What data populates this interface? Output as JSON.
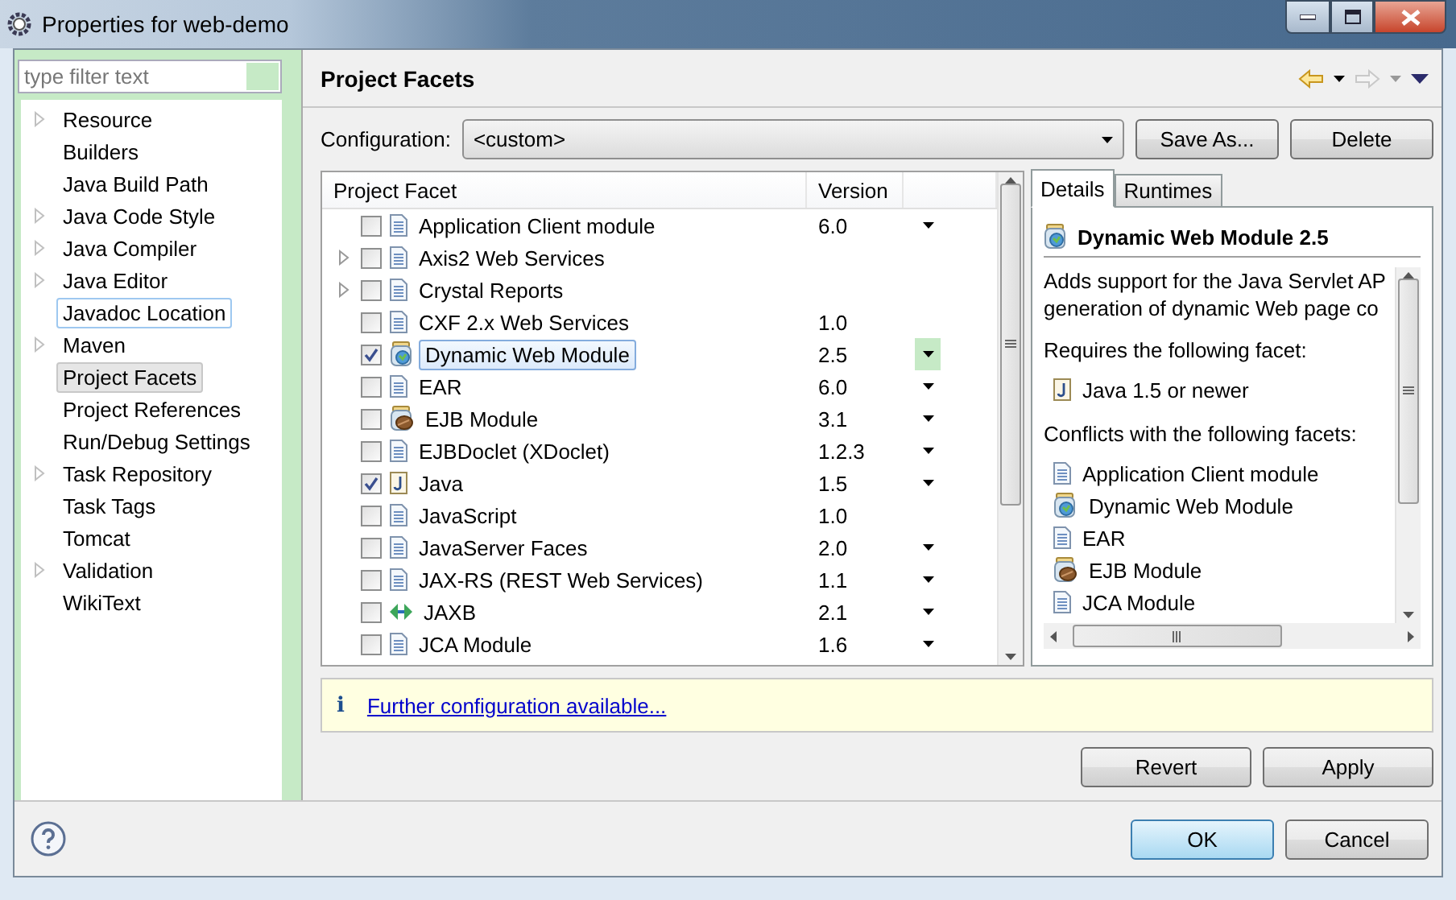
{
  "window": {
    "title": "Properties for web-demo"
  },
  "filter": {
    "placeholder": "type filter text"
  },
  "sidebar": {
    "items": [
      {
        "label": "Resource",
        "expandable": true,
        "selected": false,
        "hovered": false
      },
      {
        "label": "Builders",
        "expandable": false,
        "selected": false,
        "hovered": false
      },
      {
        "label": "Java Build Path",
        "expandable": false,
        "selected": false,
        "hovered": false
      },
      {
        "label": "Java Code Style",
        "expandable": true,
        "selected": false,
        "hovered": false
      },
      {
        "label": "Java Compiler",
        "expandable": true,
        "selected": false,
        "hovered": false
      },
      {
        "label": "Java Editor",
        "expandable": true,
        "selected": false,
        "hovered": false
      },
      {
        "label": "Javadoc Location",
        "expandable": false,
        "selected": false,
        "hovered": true
      },
      {
        "label": "Maven",
        "expandable": true,
        "selected": false,
        "hovered": false
      },
      {
        "label": "Project Facets",
        "expandable": false,
        "selected": true,
        "hovered": false
      },
      {
        "label": "Project References",
        "expandable": false,
        "selected": false,
        "hovered": false
      },
      {
        "label": "Run/Debug Settings",
        "expandable": false,
        "selected": false,
        "hovered": false
      },
      {
        "label": "Task Repository",
        "expandable": true,
        "selected": false,
        "hovered": false
      },
      {
        "label": "Task Tags",
        "expandable": false,
        "selected": false,
        "hovered": false
      },
      {
        "label": "Tomcat",
        "expandable": false,
        "selected": false,
        "hovered": false
      },
      {
        "label": "Validation",
        "expandable": true,
        "selected": false,
        "hovered": false
      },
      {
        "label": "WikiText",
        "expandable": false,
        "selected": false,
        "hovered": false
      }
    ]
  },
  "page": {
    "title": "Project Facets"
  },
  "configuration": {
    "label": "Configuration:",
    "value": "<custom>",
    "buttons": [
      "Save As...",
      "Delete"
    ]
  },
  "table": {
    "columns": [
      "Project Facet",
      "Version"
    ],
    "rows": [
      {
        "kind": "doc",
        "label": "Application Client module",
        "version": "6.0",
        "menu": true,
        "checked": false,
        "expandable": false,
        "selected": false
      },
      {
        "kind": "doc",
        "label": "Axis2 Web Services",
        "menu": false,
        "checked": false,
        "expandable": true,
        "selected": false
      },
      {
        "kind": "doc",
        "label": "Crystal Reports",
        "menu": false,
        "checked": false,
        "expandable": true,
        "selected": false
      },
      {
        "kind": "doc",
        "label": "CXF 2.x Web Services",
        "version": "1.0",
        "menu": false,
        "checked": false,
        "expandable": false,
        "selected": false
      },
      {
        "kind": "web",
        "label": "Dynamic Web Module",
        "version": "2.5",
        "menu": true,
        "checked": true,
        "expandable": false,
        "selected": true
      },
      {
        "kind": "doc",
        "label": "EAR",
        "version": "6.0",
        "menu": true,
        "checked": false,
        "expandable": false,
        "selected": false
      },
      {
        "kind": "bean",
        "label": "EJB Module",
        "version": "3.1",
        "menu": true,
        "checked": false,
        "expandable": false,
        "selected": false
      },
      {
        "kind": "doc",
        "label": "EJBDoclet (XDoclet)",
        "version": "1.2.3",
        "menu": true,
        "checked": false,
        "expandable": false,
        "selected": false
      },
      {
        "kind": "java",
        "label": "Java",
        "version": "1.5",
        "menu": true,
        "checked": true,
        "expandable": false,
        "selected": false
      },
      {
        "kind": "doc",
        "label": "JavaScript",
        "version": "1.0",
        "menu": false,
        "checked": false,
        "expandable": false,
        "selected": false
      },
      {
        "kind": "doc",
        "label": "JavaServer Faces",
        "version": "2.0",
        "menu": true,
        "checked": false,
        "expandable": false,
        "selected": false
      },
      {
        "kind": "doc",
        "label": "JAX-RS (REST Web Services)",
        "version": "1.1",
        "menu": true,
        "checked": false,
        "expandable": false,
        "selected": false
      },
      {
        "kind": "arrows",
        "label": "JAXB",
        "version": "2.1",
        "menu": true,
        "checked": false,
        "expandable": false,
        "selected": false
      },
      {
        "kind": "doc",
        "label": "JCA Module",
        "version": "1.6",
        "menu": true,
        "checked": false,
        "expandable": false,
        "selected": false
      }
    ]
  },
  "tabs": [
    {
      "label": "Details",
      "selected": true
    },
    {
      "label": "Runtimes",
      "selected": false
    }
  ],
  "details": {
    "kind": "web",
    "title": "Dynamic Web Module 2.5",
    "description": [
      "Adds support for the Java Servlet AP",
      "generation of dynamic Web page co"
    ],
    "requires_heading": "Requires the following facet:",
    "requires": [
      {
        "kind": "java",
        "label": "Java 1.5 or newer"
      }
    ],
    "conflicts_heading": "Conflicts with the following facets:",
    "conflicts": [
      {
        "kind": "doc",
        "label": "Application Client module"
      },
      {
        "kind": "web",
        "label": "Dynamic Web Module"
      },
      {
        "kind": "doc",
        "label": "EAR"
      },
      {
        "kind": "bean",
        "label": "EJB Module"
      },
      {
        "kind": "doc",
        "label": "JCA Module"
      }
    ]
  },
  "info": {
    "icon": "i",
    "link": "Further configuration available..."
  },
  "page_buttons": [
    "Revert",
    "Apply"
  ],
  "dialog_buttons": [
    {
      "label": "OK",
      "default": true
    },
    {
      "label": "Cancel",
      "default": false
    }
  ]
}
